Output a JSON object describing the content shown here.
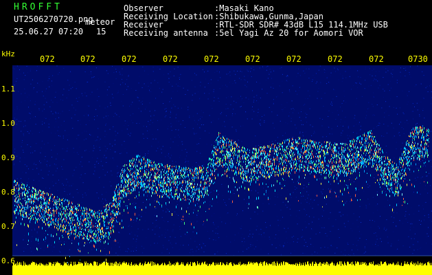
{
  "app_title": "HROFFT",
  "file_name": "UT2506270720.png",
  "mode_label": "meteor",
  "date_time": "25.06.27 07:20",
  "count": "15",
  "header": {
    "rows": [
      {
        "label": "Observer",
        "value": ":Masaki Kano"
      },
      {
        "label": "Receiving Location",
        "value": ":Shibukawa,Gunma,Japan"
      },
      {
        "label": "Receiver",
        "value": ":RTL-SDR SDR# 43dB L15 114.1MHz USB"
      },
      {
        "label": "Receiving antenna",
        "value": ":5el Yagi Az 20 for Aomori VOR"
      }
    ]
  },
  "freq_axis": {
    "unit": "kHz",
    "ticks": [
      "1.1",
      "1.0",
      "0.9",
      "0.8",
      "0.7",
      "0.6"
    ]
  },
  "time_axis": {
    "ticks": [
      "072",
      "072",
      "072",
      "072",
      "072",
      "072",
      "072",
      "072",
      "072",
      "0730"
    ]
  },
  "colors": {
    "title": "#33ff33",
    "text": "#ffffff",
    "axis_text": "#ffff00",
    "spectrum": "#ffff00",
    "background": "#000000",
    "noise": "#000c6a",
    "baseline": "#3050a0"
  }
}
